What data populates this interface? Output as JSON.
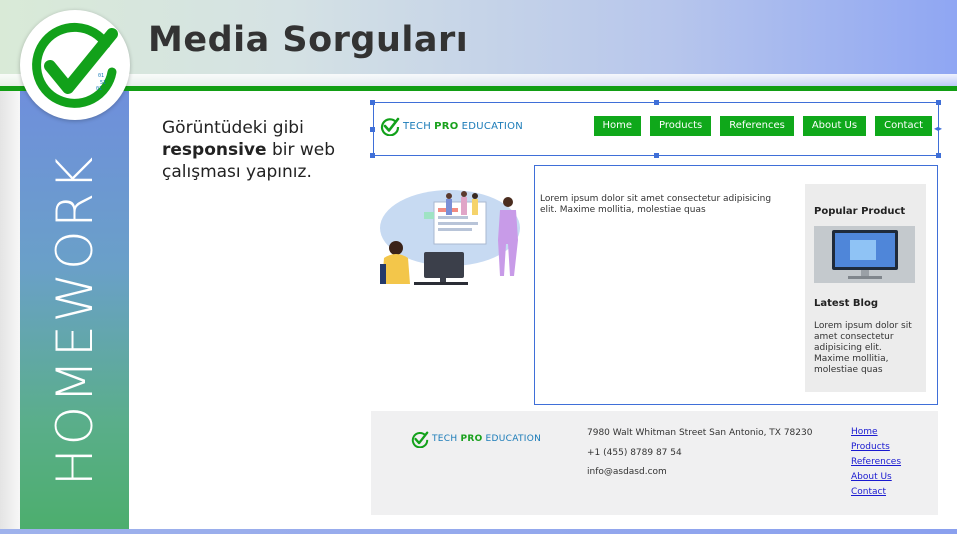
{
  "slide": {
    "title": "Media Sorguları",
    "side_label": "HOMEWORK",
    "instruction_pre": "Görüntüdeki gibi ",
    "instruction_bold": "responsive",
    "instruction_post": " bir web çalışması yapınız.",
    "logo_digits_top": "01",
    "logo_digits_mid": "51",
    "logo_digits_bot": "01"
  },
  "mockup": {
    "brand": {
      "part1": "TECH",
      "part2": "PRO",
      "part3": "EDUCATION"
    },
    "nav": [
      "Home",
      "Products",
      "References",
      "About Us",
      "Contact"
    ],
    "main_text": "Lorem ipsum dolor sit amet consectetur adipisicing elit. Maxime mollitia, molestiae quas",
    "sidebar": {
      "popular_title": "Popular Product",
      "blog_title": "Latest Blog",
      "blog_text": "Lorem ipsum dolor sit amet consectetur adipisicing elit. Maxime mollitia, molestiae quas"
    },
    "footer": {
      "address": "7980 Walt Whitman Street San Antonio, TX 78230",
      "phone": "+1 (455) 8789 87 54",
      "email": "info@asdasd.com",
      "links": [
        "Home",
        "Products",
        "References",
        "About Us",
        "Contact"
      ]
    }
  },
  "colors": {
    "accent_green": "#0fa81a",
    "selection_blue": "#3f6fd8",
    "link_blue": "#1a1ad0"
  }
}
